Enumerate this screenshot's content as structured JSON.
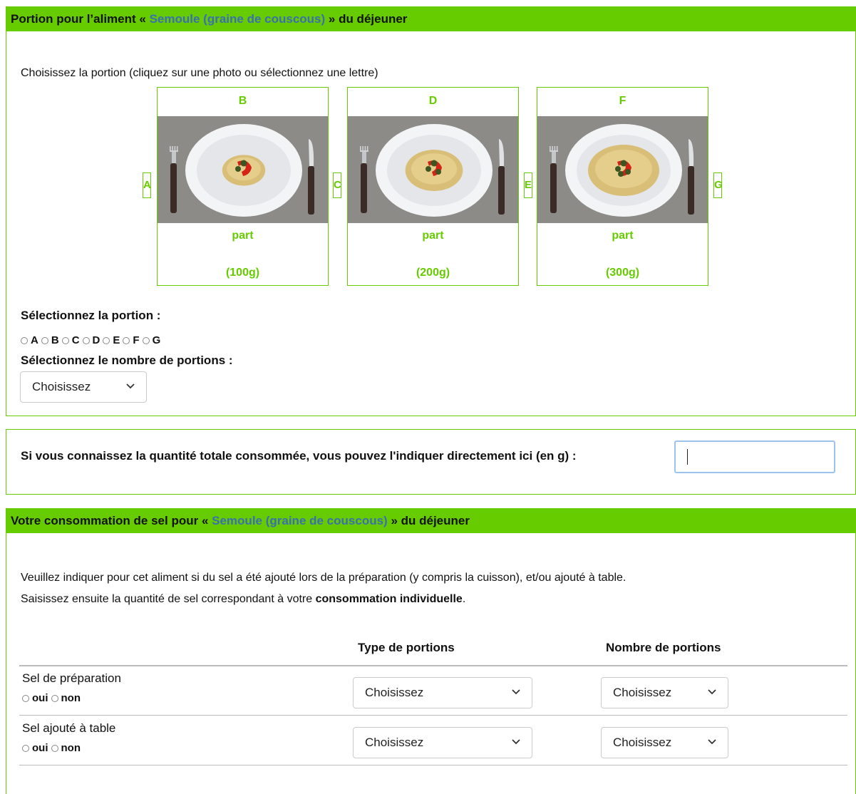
{
  "portion_panel": {
    "title_prefix": "Portion pour l’aliment «",
    "food_name": "Semoule (graine de couscous)",
    "title_suffix": "» du déjeuner",
    "instruction": "Choisissez la portion (cliquez sur une photo ou sélectionnez une lettre)",
    "cards": [
      {
        "letter": "B",
        "part": "part",
        "weight": "(100g)",
        "size": 0.55
      },
      {
        "letter": "D",
        "part": "part",
        "weight": "(200g)",
        "size": 0.78
      },
      {
        "letter": "F",
        "part": "part",
        "weight": "(300g)",
        "size": 1.0
      }
    ],
    "side_letters": [
      "A",
      "C",
      "E",
      "G"
    ],
    "select_portion_label": "Sélectionnez la portion :",
    "portion_options": [
      "A",
      "B",
      "C",
      "D",
      "E",
      "F",
      "G"
    ],
    "select_count_label": "Sélectionnez le nombre de portions :",
    "count_select_value": "Choisissez"
  },
  "quantity_panel": {
    "label": "Si vous connaissez la quantité totale consommée, vous pouvez l'indiquer directement ici (en g) :",
    "input_value": ""
  },
  "salt_panel": {
    "title_prefix": "Votre consommation de sel pour «",
    "food_name": "Semoule (graine de couscous)",
    "title_suffix": "» du déjeuner",
    "instruction_line1": "Veuillez indiquer pour cet aliment si du sel a été ajouté lors de la préparation (y compris la cuisson), et/ou ajouté à table.",
    "instruction_line2_pre": "Saisissez ensuite la quantité de sel correspondant à votre ",
    "instruction_line2_bold": "consommation individuelle",
    "instruction_line2_post": ".",
    "col_type": "Type de portions",
    "col_count": "Nombre de portions",
    "rows": [
      {
        "label": "Sel de préparation",
        "yes": "oui",
        "no": "non",
        "type_value": "Choisissez",
        "count_value": "Choisissez"
      },
      {
        "label": "Sel ajouté à table",
        "yes": "oui",
        "no": "non",
        "type_value": "Choisissez",
        "count_value": "Choisissez"
      }
    ]
  },
  "colors": {
    "accent": "#66cc00",
    "food_link": "#3a6fb0"
  }
}
